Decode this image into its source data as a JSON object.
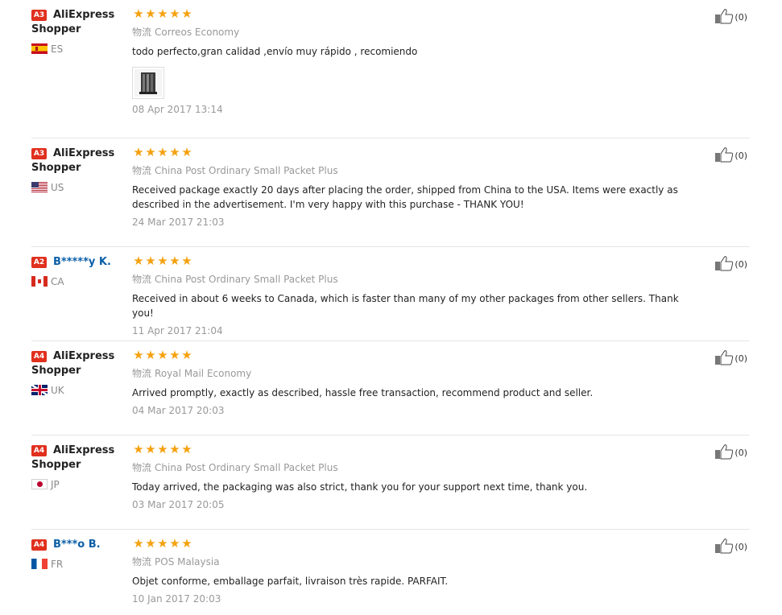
{
  "reviews": [
    {
      "level": "A3",
      "user_line1": "AliExpress",
      "user_line2": "Shopper",
      "anonymous": false,
      "country": "ES",
      "flag": "es",
      "stars": 5,
      "shipping_icon": "物流",
      "shipping": "Correos Economy",
      "text": "todo perfecto,gran calidad ,envío muy rápido , recomiendo",
      "has_photo": true,
      "date": "08 Apr 2017 13:14",
      "helpful": "(0)"
    },
    {
      "level": "A3",
      "user_line1": "AliExpress",
      "user_line2": "Shopper",
      "anonymous": false,
      "country": "US",
      "flag": "us",
      "stars": 5,
      "shipping_icon": "物流",
      "shipping": "China Post Ordinary Small Packet Plus",
      "text": "Received package exactly 20 days after placing the order, shipped from China to the USA. Items were exactly as described in the advertisement. I'm very happy with this purchase - THANK YOU!",
      "has_photo": false,
      "date": "24 Mar 2017 21:03",
      "helpful": "(0)"
    },
    {
      "level": "A2",
      "user_line1": "B*****y K.",
      "user_line2": "",
      "anonymous": true,
      "country": "CA",
      "flag": "ca",
      "stars": 5,
      "shipping_icon": "物流",
      "shipping": "China Post Ordinary Small Packet Plus",
      "text": "Received in about 6 weeks to Canada, which is faster than many of my other packages from other sellers. Thank you!",
      "has_photo": false,
      "date": "11 Apr 2017 21:04",
      "helpful": "(0)"
    },
    {
      "level": "A4",
      "user_line1": "AliExpress",
      "user_line2": "Shopper",
      "anonymous": false,
      "country": "UK",
      "flag": "uk",
      "stars": 5,
      "shipping_icon": "物流",
      "shipping": "Royal Mail Economy",
      "text": "Arrived promptly, exactly as described, hassle free transaction, recommend product and seller.",
      "has_photo": false,
      "date": "04 Mar 2017 20:03",
      "helpful": "(0)"
    },
    {
      "level": "A4",
      "user_line1": "AliExpress",
      "user_line2": "Shopper",
      "anonymous": false,
      "country": "JP",
      "flag": "jp",
      "stars": 5,
      "shipping_icon": "物流",
      "shipping": "China Post Ordinary Small Packet Plus",
      "text": "Today arrived, the packaging was also strict, thank you for your support next time, thank you.",
      "has_photo": false,
      "date": "03 Mar 2017 20:05",
      "helpful": "(0)"
    },
    {
      "level": "A4",
      "user_line1": "B***o B.",
      "user_line2": "",
      "anonymous": true,
      "country": "FR",
      "flag": "fr",
      "stars": 5,
      "shipping_icon": "物流",
      "shipping": "POS Malaysia",
      "text": "Objet conforme, emballage parfait, livraison très rapide. PARFAIT.",
      "has_photo": false,
      "date": "10 Jan 2017 20:03",
      "helpful": "(0)"
    }
  ],
  "colors": {
    "star": "#f5a10f",
    "level_badge": "#e0301e",
    "link": "#0a5fa8"
  }
}
